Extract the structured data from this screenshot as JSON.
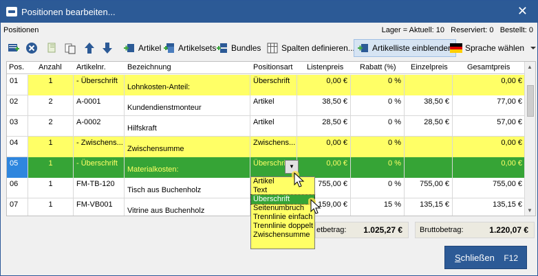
{
  "window": {
    "title": "Positionen bearbeiten...",
    "close_glyph": "✕"
  },
  "info": {
    "section": "Positionen",
    "stock": "Lager = Aktuell: 10   Reserviert: 0   Bestellt: 0"
  },
  "toolbar": {
    "artikel": "Artikel",
    "artikelsets": "Artikelsets",
    "bundles": "Bundles",
    "spalten": "Spalten definieren...",
    "artikelliste": "Artikelliste einblenden",
    "sprache": "Sprache wählen",
    "icons": [
      "add-row-icon",
      "delete-icon",
      "copy-icon",
      "paste-icon",
      "arrow-up-icon",
      "arrow-down-icon"
    ]
  },
  "table": {
    "headers": [
      "Pos.",
      "Anzahl",
      "Artikelnr.",
      "Bezeichnung",
      "Positionsart",
      "Listenpreis",
      "Rabatt (%)",
      "Einzelpreis",
      "Gesamtpreis"
    ],
    "rows": [
      {
        "pos": "01",
        "anzahl": "1",
        "artikelnr": "- Überschrift",
        "bezeichnung": "Lohnkosten-Anteil:",
        "art": "Überschrift",
        "listenpreis": "0,00 €",
        "rabatt": "0 %",
        "einzelpreis": "",
        "gesamtpreis": "0,00 €",
        "style": "yellow"
      },
      {
        "pos": "02",
        "anzahl": "2",
        "artikelnr": "A-0001",
        "bezeichnung": "Kundendienstmonteur",
        "art": "Artikel",
        "listenpreis": "38,50 €",
        "rabatt": "0 %",
        "einzelpreis": "38,50 €",
        "gesamtpreis": "77,00 €",
        "style": "white"
      },
      {
        "pos": "03",
        "anzahl": "2",
        "artikelnr": "A-0002",
        "bezeichnung": "Hilfskraft",
        "art": "Artikel",
        "listenpreis": "28,50 €",
        "rabatt": "0 %",
        "einzelpreis": "28,50 €",
        "gesamtpreis": "57,00 €",
        "style": "white"
      },
      {
        "pos": "04",
        "anzahl": "1",
        "artikelnr": "- Zwischens...",
        "bezeichnung": "Zwischensumme",
        "art": "Zwischens...",
        "listenpreis": "0,00 €",
        "rabatt": "0 %",
        "einzelpreis": "",
        "gesamtpreis": "0,00 €",
        "style": "yellow"
      },
      {
        "pos": "05",
        "anzahl": "1",
        "artikelnr": "- Überschrift",
        "bezeichnung": "Materialkosten:",
        "art": "Überschrift",
        "listenpreis": "0,00 €",
        "rabatt": "0 %",
        "einzelpreis": "",
        "gesamtpreis": "0,00 €",
        "style": "green"
      },
      {
        "pos": "06",
        "anzahl": "1",
        "artikelnr": "FM-TB-120",
        "bezeichnung": "Tisch aus Buchenholz",
        "art": "",
        "listenpreis": "755,00 €",
        "rabatt": "0 %",
        "einzelpreis": "755,00 €",
        "gesamtpreis": "755,00 €",
        "style": "white"
      },
      {
        "pos": "07",
        "anzahl": "1",
        "artikelnr": "FM-VB001",
        "bezeichnung": "Vitrine aus Buchenholz",
        "art": "",
        "listenpreis": "159,00 €",
        "rabatt": "15 %",
        "einzelpreis": "135,15 €",
        "gesamtpreis": "135,15 €",
        "style": "white"
      }
    ]
  },
  "dropdown": {
    "options": [
      "Artikel",
      "Text",
      "Überschrift",
      "Seitenumbruch",
      "Trennlinie einfach",
      "Trennlinie doppelt",
      "Zwischensumme"
    ],
    "selected_index": 2
  },
  "totals": {
    "netto_label": "etbetrag:",
    "netto_value": "1.025,27 €",
    "brutto_label": "Bruttobetrag:",
    "brutto_value": "1.220,07 €"
  },
  "buttons": {
    "close_first": "S",
    "close_rest": "chließen",
    "close_shortcut": "F12"
  },
  "colors": {
    "titlebar": "#2c5a96",
    "highlight_yellow": "#ffff66",
    "selected_green": "#36a436",
    "selected_pos": "#2e86de"
  }
}
